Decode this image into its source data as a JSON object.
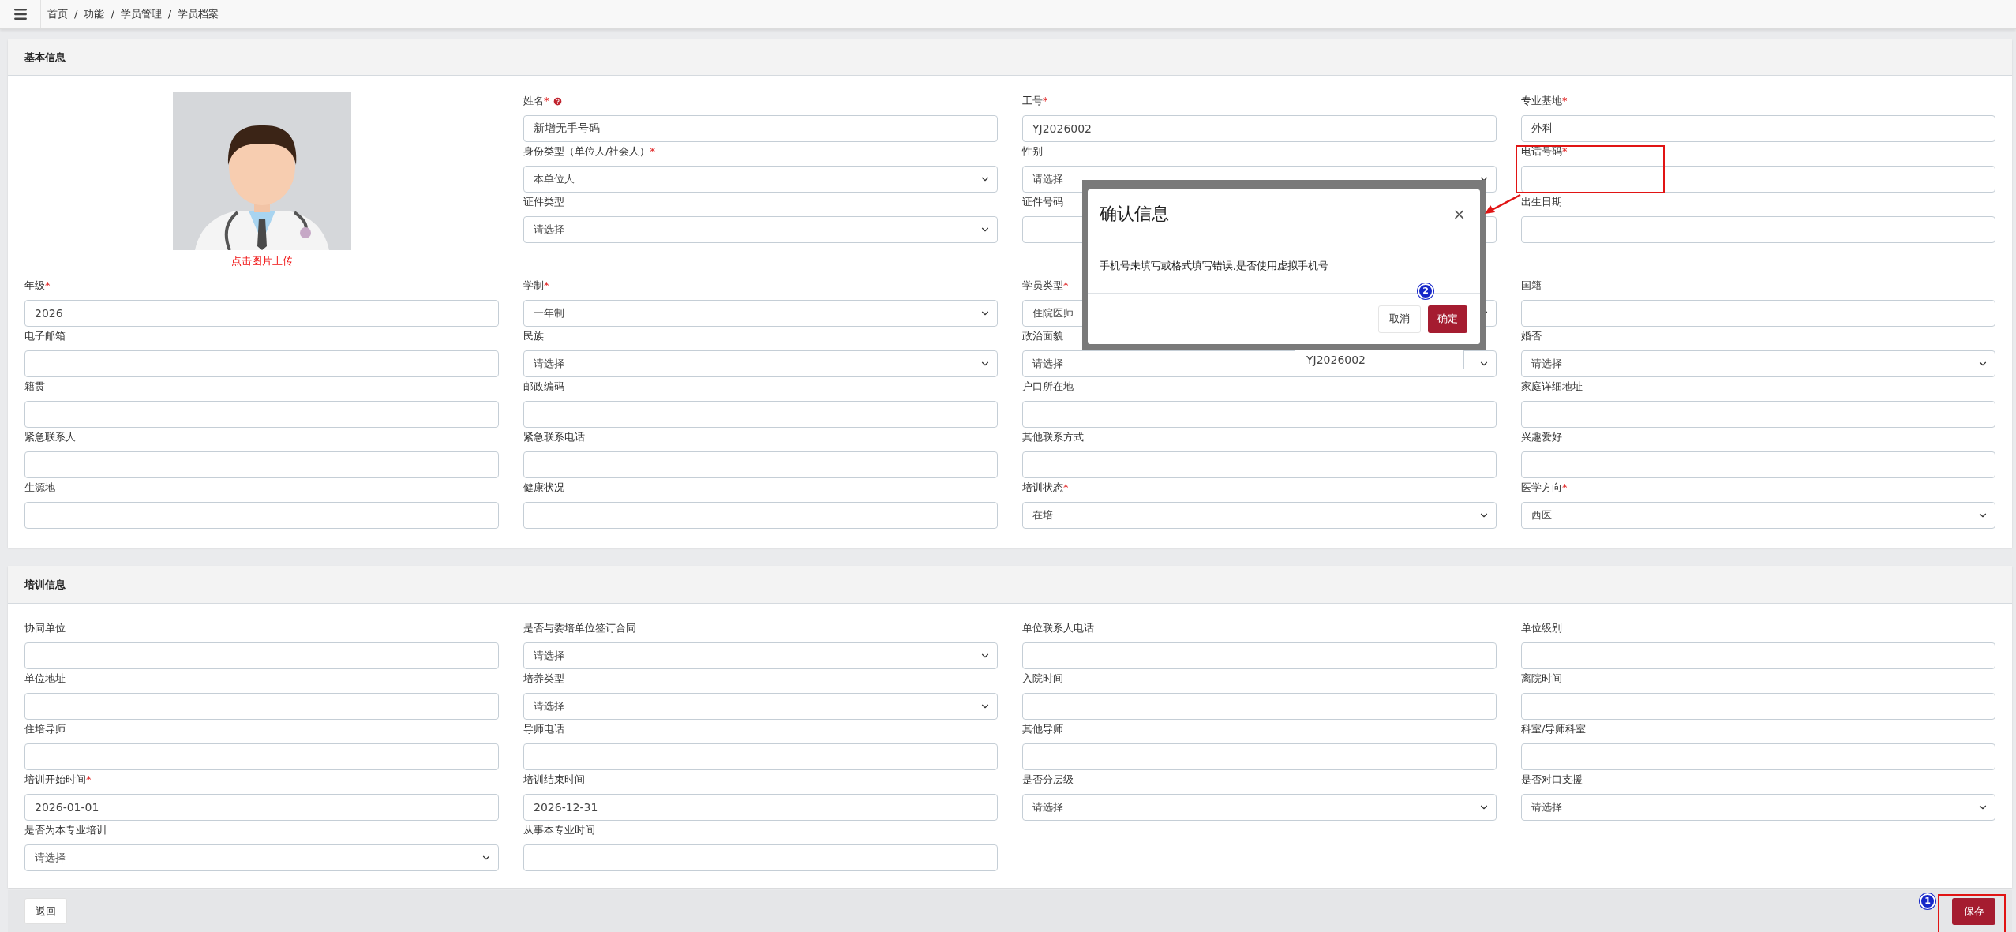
{
  "topbar": {
    "breadcrumb": [
      "首页",
      "功能",
      "学员管理",
      "学员档案"
    ],
    "separator": "/"
  },
  "basic": {
    "title": "基本信息",
    "avatar_caption": "点击图片上传",
    "top_rows": [
      [
        {
          "label": "姓名",
          "asterisk": "*",
          "help": true,
          "kind": "input",
          "value": "新增无手号码"
        },
        {
          "label": "工号",
          "asterisk": "*",
          "kind": "input",
          "value": "YJ2026002"
        },
        {
          "label": "专业基地",
          "asterisk": "*",
          "kind": "input",
          "value": "外科"
        }
      ],
      [
        {
          "label": "身份类型（单位人/社会人）",
          "asterisk": "*",
          "kind": "select",
          "value": "本单位人"
        },
        {
          "label": "性别",
          "kind": "select",
          "value": "请选择"
        },
        {
          "label": "电话号码",
          "asterisk": "*",
          "kind": "input"
        }
      ],
      [
        {
          "label": "证件类型",
          "kind": "select",
          "value": "请选择"
        },
        {
          "label": "证件号码",
          "kind": "input"
        },
        {
          "label": "出生日期",
          "kind": "input"
        }
      ]
    ],
    "rows": [
      [
        {
          "label": "年级",
          "asterisk": "*",
          "kind": "input",
          "value": "2026"
        },
        {
          "label": "学制",
          "asterisk": "*",
          "kind": "select",
          "value": "一年制"
        },
        {
          "label": "学员类型",
          "asterisk": "*",
          "kind": "select",
          "value": "住院医师"
        },
        {
          "label": "国籍",
          "kind": "input"
        }
      ],
      [
        {
          "label": "电子邮箱",
          "kind": "input"
        },
        {
          "label": "民族",
          "kind": "select",
          "value": "请选择"
        },
        {
          "label": "政治面貌",
          "kind": "select",
          "value": "请选择"
        },
        {
          "label": "婚否",
          "kind": "select",
          "value": "请选择"
        }
      ],
      [
        {
          "label": "籍贯",
          "kind": "input"
        },
        {
          "label": "邮政编码",
          "kind": "input"
        },
        {
          "label": "户口所在地",
          "kind": "input"
        },
        {
          "label": "家庭详细地址",
          "kind": "input"
        }
      ],
      [
        {
          "label": "紧急联系人",
          "kind": "input"
        },
        {
          "label": "紧急联系电话",
          "kind": "input"
        },
        {
          "label": "其他联系方式",
          "kind": "input"
        },
        {
          "label": "兴趣爱好",
          "kind": "input"
        }
      ],
      [
        {
          "label": "生源地",
          "kind": "input"
        },
        {
          "label": "健康状况",
          "kind": "input"
        },
        {
          "label": "培训状态",
          "asterisk": "*",
          "kind": "select",
          "value": "在培"
        },
        {
          "label": "医学方向",
          "asterisk": "*",
          "kind": "select",
          "value": "西医"
        }
      ]
    ]
  },
  "training": {
    "title": "培训信息",
    "rows": [
      [
        {
          "label": "协同单位",
          "kind": "input"
        },
        {
          "label": "是否与委培单位签订合同",
          "kind": "select",
          "value": "请选择"
        },
        {
          "label": "单位联系人电话",
          "kind": "input"
        },
        {
          "label": "单位级别",
          "kind": "input"
        }
      ],
      [
        {
          "label": "单位地址",
          "kind": "input"
        },
        {
          "label": "培养类型",
          "kind": "select",
          "value": "请选择"
        },
        {
          "label": "入院时间",
          "kind": "input"
        },
        {
          "label": "离院时间",
          "kind": "input"
        }
      ],
      [
        {
          "label": "住培导师",
          "kind": "input"
        },
        {
          "label": "导师电话",
          "kind": "input"
        },
        {
          "label": "其他导师",
          "kind": "input"
        },
        {
          "label": "科室/导师科室",
          "kind": "input"
        }
      ],
      [
        {
          "label": "培训开始时间",
          "asterisk": "*",
          "kind": "input",
          "value": "2026-01-01"
        },
        {
          "label": "培训结束时间",
          "kind": "input",
          "value": "2026-12-31"
        },
        {
          "label": "是否分层级",
          "kind": "select",
          "value": "请选择"
        },
        {
          "label": "是否对口支援",
          "kind": "select",
          "value": "请选择"
        }
      ],
      [
        {
          "label": "是否为本专业培训",
          "kind": "select",
          "value": "请选择"
        },
        {
          "label": "从事本专业时间",
          "kind": "input"
        }
      ]
    ]
  },
  "footer": {
    "back_button": "返回",
    "save_button": "保存",
    "save_badge": "1"
  },
  "autocomplete": {
    "value": "YJ2026002"
  },
  "dialog": {
    "title": "确认信息",
    "close": "×",
    "message": "手机号未填写或格式填写错误,是否使用虚拟手机号",
    "cancel_button": "取消",
    "confirm_button": "确定",
    "confirm_badge": "2"
  }
}
